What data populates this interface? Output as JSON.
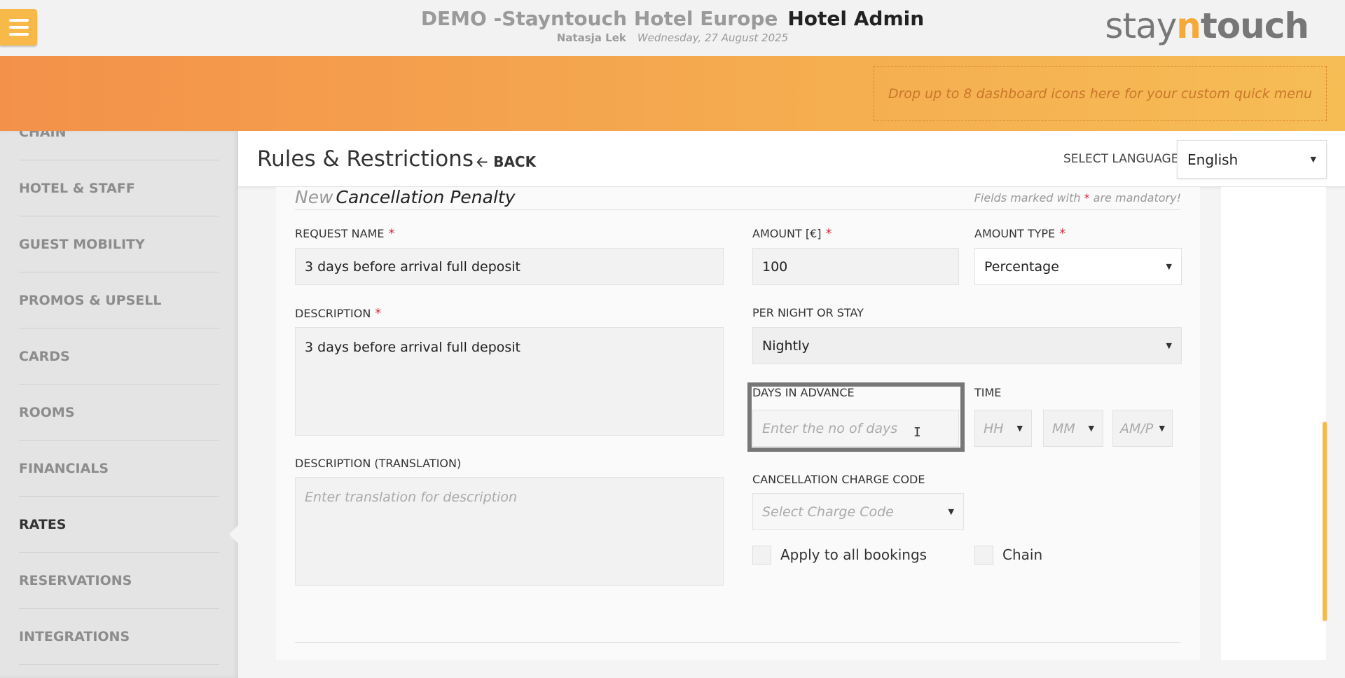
{
  "header": {
    "hotel_name": "DEMO -Stayntouch Hotel Europe",
    "app_name": "Hotel Admin",
    "user_name": "Natasja Lek",
    "date": "Wednesday, 27 August 2025",
    "logo_pre": "stay",
    "logo_n": "n",
    "logo_post": "touch"
  },
  "quick_menu": {
    "placeholder": "Drop up to 8 dashboard icons here for your custom quick menu"
  },
  "sidebar": {
    "items": [
      {
        "label": "CHAIN"
      },
      {
        "label": "HOTEL & STAFF"
      },
      {
        "label": "GUEST MOBILITY"
      },
      {
        "label": "PROMOS & UPSELL"
      },
      {
        "label": "CARDS"
      },
      {
        "label": "ROOMS"
      },
      {
        "label": "FINANCIALS"
      },
      {
        "label": "RATES"
      },
      {
        "label": "RESERVATIONS"
      },
      {
        "label": "INTEGRATIONS"
      }
    ],
    "active": "RATES"
  },
  "titlebar": {
    "title": "Rules & Restrictions",
    "back_label": "BACK",
    "select_language_label": "SELECT LANGUAGE",
    "language_value": "English"
  },
  "form": {
    "title_prefix": "New",
    "title": "Cancellation Penalty",
    "mandatory_pre": "Fields marked with",
    "mandatory_star": "*",
    "mandatory_post": "are mandatory!",
    "request_name": {
      "label": "REQUEST NAME",
      "value": "3 days before arrival full deposit"
    },
    "description": {
      "label": "DESCRIPTION",
      "value": "3 days before arrival full deposit"
    },
    "description_translation": {
      "label": "DESCRIPTION (TRANSLATION)",
      "placeholder": "Enter translation for description"
    },
    "amount": {
      "label": "AMOUNT [€]",
      "value": "100"
    },
    "amount_type": {
      "label": "AMOUNT TYPE",
      "value": "Percentage"
    },
    "per_night_or_stay": {
      "label": "PER NIGHT OR STAY",
      "value": "Nightly"
    },
    "days_in_advance": {
      "label": "DAYS IN ADVANCE",
      "placeholder": "Enter the no of days"
    },
    "time": {
      "label": "TIME",
      "hh": "HH",
      "mm": "MM",
      "ampm": "AM/P"
    },
    "charge_code": {
      "label": "CANCELLATION CHARGE CODE",
      "placeholder": "Select Charge Code"
    },
    "apply_all_label": "Apply to all bookings",
    "chain_label": "Chain",
    "required_mark": "*"
  }
}
